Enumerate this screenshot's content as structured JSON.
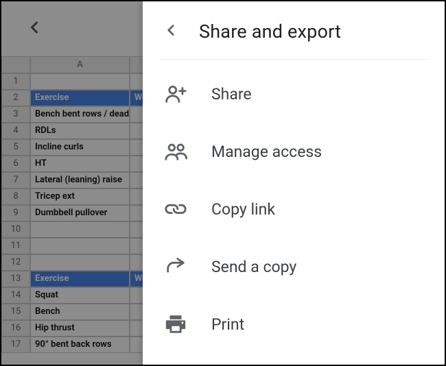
{
  "sheet": {
    "column_header": "A",
    "header_b": "",
    "rows": [
      {
        "num": "1",
        "a": "",
        "b": "",
        "hdr": false
      },
      {
        "num": "2",
        "a": "Exercise",
        "b": "Weight",
        "hdr": true
      },
      {
        "num": "3",
        "a": "Bench bent rows / dead",
        "b": "",
        "hdr": false
      },
      {
        "num": "4",
        "a": "RDLs",
        "b": "",
        "hdr": false
      },
      {
        "num": "5",
        "a": "Incline curls",
        "b": "",
        "hdr": false
      },
      {
        "num": "6",
        "a": "HT",
        "b": "",
        "hdr": false
      },
      {
        "num": "7",
        "a": "Lateral (leaning) raise",
        "b": "",
        "hdr": false
      },
      {
        "num": "8",
        "a": "Tricep ext",
        "b": "",
        "hdr": false
      },
      {
        "num": "9",
        "a": "Dumbbell pullover",
        "b": "",
        "hdr": false
      },
      {
        "num": "10",
        "a": "",
        "b": "",
        "hdr": false
      },
      {
        "num": "11",
        "a": "",
        "b": "",
        "hdr": false
      },
      {
        "num": "12",
        "a": "",
        "b": "",
        "hdr": false
      },
      {
        "num": "13",
        "a": "Exercise",
        "b": "Weight",
        "hdr": true
      },
      {
        "num": "14",
        "a": "Squat",
        "b": "",
        "hdr": false
      },
      {
        "num": "15",
        "a": "Bench",
        "b": "",
        "hdr": false
      },
      {
        "num": "16",
        "a": "Hip thrust",
        "b": "",
        "hdr": false
      },
      {
        "num": "17",
        "a": "90° bent back rows",
        "b": "",
        "hdr": false
      }
    ]
  },
  "panel": {
    "title": "Share and export",
    "items": [
      {
        "id": "share",
        "label": "Share"
      },
      {
        "id": "manage-access",
        "label": "Manage access"
      },
      {
        "id": "copy-link",
        "label": "Copy link"
      },
      {
        "id": "send-a-copy",
        "label": "Send a copy"
      },
      {
        "id": "print",
        "label": "Print"
      }
    ]
  }
}
